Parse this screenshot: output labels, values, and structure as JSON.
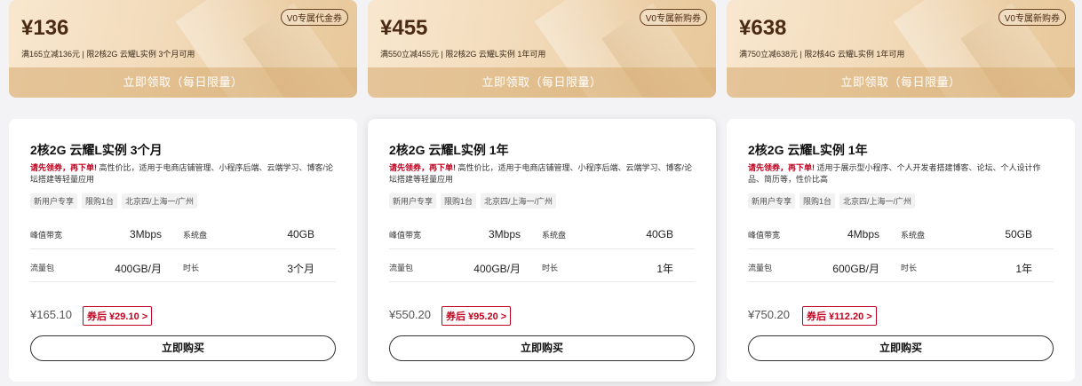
{
  "offers": [
    {
      "coupon": {
        "amount": "¥136",
        "tag": "V0专属代金券",
        "desc": "满165立减136元 | 限2核2G 云耀L实例 3个月可用",
        "button": "立即领取（每日限量）"
      },
      "product": {
        "title": "2核2G 云耀L实例 3个月",
        "desc_highlight": "请先领券，再下单!",
        "desc_rest": " 高性价比，适用于电商店铺管理、小程序后端、云端学习、博客/论坛搭建等轻量应用",
        "tags": [
          "新用户专享",
          "限购1台",
          "北京四/上海一/广州"
        ],
        "specs": {
          "bandwidth_label": "峰值带宽",
          "bandwidth_value": "3Mbps",
          "disk_label": "系统盘",
          "disk_value": "40GB",
          "traffic_label": "流量包",
          "traffic_value": "400GB/月",
          "duration_label": "时长",
          "duration_value": "3个月"
        },
        "price": "¥165.10",
        "after_coupon": "券后 ¥29.10 >",
        "buy_button": "立即购买"
      }
    },
    {
      "coupon": {
        "amount": "¥455",
        "tag": "V0专属新购券",
        "desc": "满550立减455元 | 限2核2G 云耀L实例 1年可用",
        "button": "立即领取（每日限量）"
      },
      "product": {
        "title": "2核2G 云耀L实例 1年",
        "desc_highlight": "请先领券，再下单!",
        "desc_rest": " 高性价比，适用于电商店铺管理、小程序后端、云端学习、博客/论坛搭建等轻量应用",
        "tags": [
          "新用户专享",
          "限购1台",
          "北京四/上海一/广州"
        ],
        "specs": {
          "bandwidth_label": "峰值带宽",
          "bandwidth_value": "3Mbps",
          "disk_label": "系统盘",
          "disk_value": "40GB",
          "traffic_label": "流量包",
          "traffic_value": "400GB/月",
          "duration_label": "时长",
          "duration_value": "1年"
        },
        "price": "¥550.20",
        "after_coupon": "券后 ¥95.20 >",
        "buy_button": "立即购买"
      }
    },
    {
      "coupon": {
        "amount": "¥638",
        "tag": "V0专属新购券",
        "desc": "满750立减638元 | 限2核4G 云耀L实例 1年可用",
        "button": "立即领取（每日限量）"
      },
      "product": {
        "title": "2核2G 云耀L实例 1年",
        "desc_highlight": "请先领券，再下单!",
        "desc_rest": " 适用于展示型小程序、个人开发者搭建博客、论坛、个人设计作品、简历等，性价比高",
        "tags": [
          "新用户专享",
          "限购1台",
          "北京四/上海一/广州"
        ],
        "specs": {
          "bandwidth_label": "峰值带宽",
          "bandwidth_value": "4Mbps",
          "disk_label": "系统盘",
          "disk_value": "50GB",
          "traffic_label": "流量包",
          "traffic_value": "600GB/月",
          "duration_label": "时长",
          "duration_value": "1年"
        },
        "price": "¥750.20",
        "after_coupon": "券后 ¥112.20 >",
        "buy_button": "立即购买"
      }
    }
  ],
  "colors": {
    "accent_red": "#c0001e",
    "coupon_text": "#4a2a12"
  }
}
